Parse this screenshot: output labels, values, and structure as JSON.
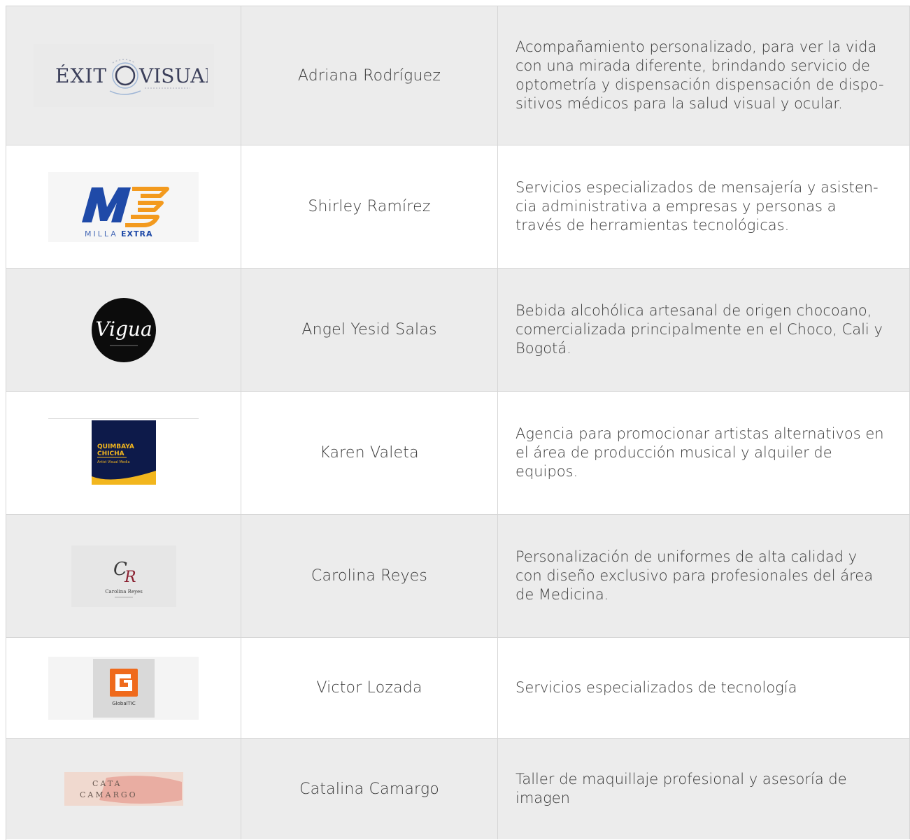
{
  "rows": [
    {
      "logo": {
        "icon": "exito-visual-logo",
        "text": "ÉXITO VISUAL"
      },
      "name": "Adriana Rodríguez",
      "description": "Acompañamiento personalizado, para ver la vida con una mirada diferente, brindando servicio de optometría y dispensación dispensación de dispo-sitivos médicos para la salud visual y ocular."
    },
    {
      "logo": {
        "icon": "milla-extra-logo",
        "text_light": "MILLA",
        "text_bold": "EXTRA"
      },
      "name": "Shirley Ramírez",
      "description": "Servicios especializados de mensajería y asisten-cia administrativa a empresas y personas a través de herramientas tecnológicas."
    },
    {
      "logo": {
        "icon": "vigua-logo",
        "text": "Vigua"
      },
      "name": "Angel Yesid Salas",
      "description": "Bebida alcohólica artesanal de origen chocoano, comercializada principalmente en el Choco, Cali y Bogotá."
    },
    {
      "logo": {
        "icon": "quimbaya-chicha-logo",
        "line1": "QUIMBAYA",
        "line2": "CHICHA",
        "line3": "Artist Visual Media"
      },
      "name": "Karen Valeta",
      "description": "Agencia para promocionar artistas alternativos en el área de producción musical y alquiler de equipos."
    },
    {
      "logo": {
        "icon": "carolina-reyes-logo",
        "monogram": "CR",
        "text": "Carolina Reyes"
      },
      "name": "Carolina Reyes",
      "description": "Personalización de uniformes de alta calidad y con diseño exclusivo para profesionales del área de Medicina."
    },
    {
      "logo": {
        "icon": "globaltic-logo",
        "text": "GlobalTIC"
      },
      "name": "Victor Lozada",
      "description": "Servicios especializados de tecnología"
    },
    {
      "logo": {
        "icon": "cata-camargo-logo",
        "line1": "CATA",
        "line2": "CAMARGO"
      },
      "name": "Catalina Camargo",
      "description": "Taller de maquillaje profesional y asesoría de imagen"
    }
  ],
  "colors": {
    "row_gray": "#ececec",
    "row_white": "#ffffff",
    "border": "#d6d6d6",
    "text": "#3a3a3a",
    "m3_blue": "#1f4aa8",
    "m3_orange": "#f39a1e",
    "global_orange": "#ef6a1c"
  }
}
